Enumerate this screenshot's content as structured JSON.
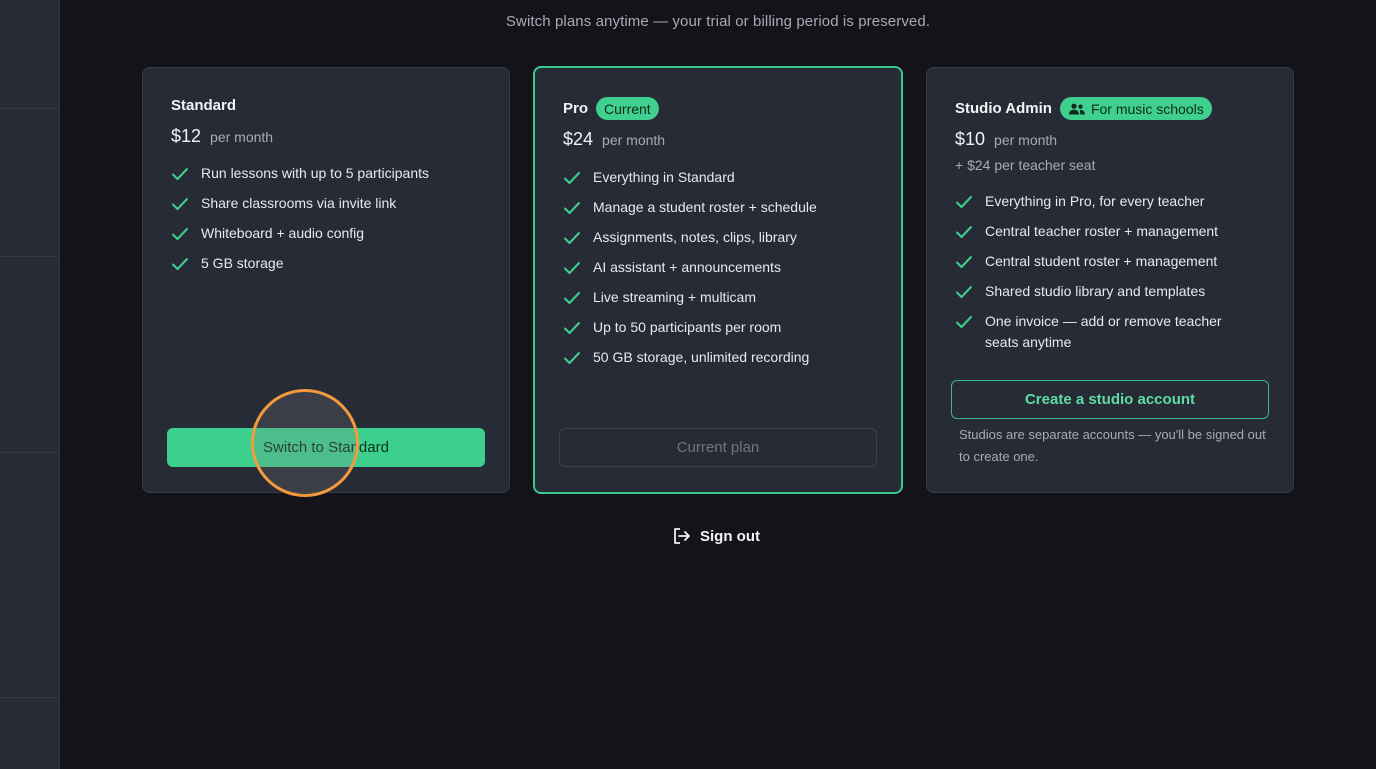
{
  "header": {
    "subtitle": "Switch plans anytime — your trial or billing period is preserved."
  },
  "plans": [
    {
      "name": "Standard",
      "badge": "",
      "price": "$12",
      "period": "per month",
      "features": [
        "Run lessons with up to 5 participants",
        "Share classrooms via invite link",
        "Whiteboard + audio config",
        "5 GB storage"
      ],
      "button": "Switch to Standard"
    },
    {
      "name": "Pro",
      "badge": "Current",
      "price": "$24",
      "period": "per month",
      "features": [
        "Everything in Standard",
        "Manage a student roster + schedule",
        "Assignments, notes, clips, library",
        "AI assistant + announcements",
        "Live streaming + multicam",
        "Up to 50 participants per room",
        "50 GB storage, unlimited recording"
      ],
      "button": "Current plan"
    },
    {
      "name": "Studio Admin",
      "badge": "For music schools",
      "price": "$10",
      "period": "per month",
      "extra": "+ $24 per teacher seat",
      "features": [
        "Everything in Pro, for every teacher",
        "Central teacher roster + management",
        "Central student roster + management",
        "Shared studio library and templates",
        "One invoice — add or remove teacher seats anytime"
      ],
      "button": "Create a studio account",
      "note": "Studios are separate accounts — you'll be signed out to create one."
    }
  ],
  "footer": {
    "sign_out": "Sign out"
  },
  "colors": {
    "accent": "#3dcf8e",
    "card_bg": "#272b35",
    "page_bg": "#131319",
    "cursor_ring": "#f49a3c"
  },
  "icons": {
    "feature_check": "check-icon",
    "studio_badge": "users-icon",
    "sign_out": "sign-out-icon"
  }
}
